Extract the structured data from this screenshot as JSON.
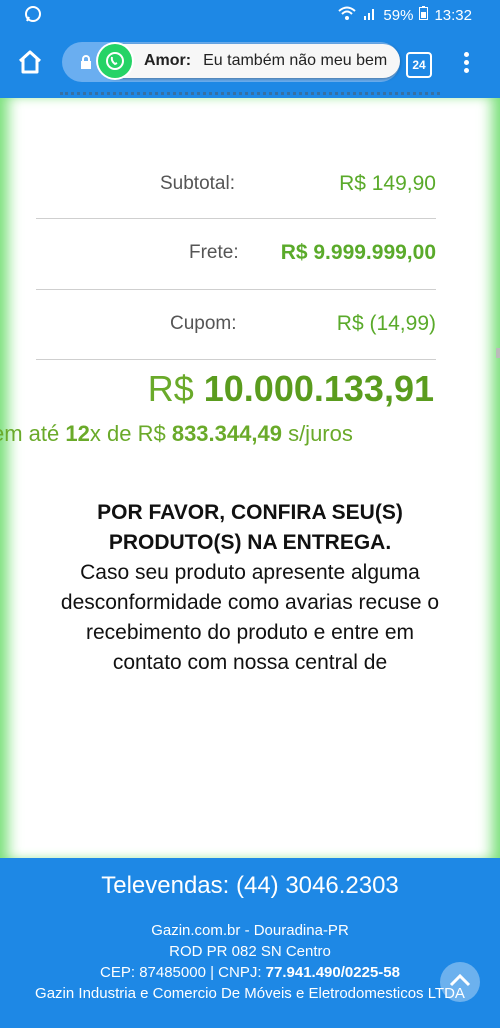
{
  "statusbar": {
    "battery": "59%",
    "time": "13:32",
    "left_icon": "whatsapp-icon"
  },
  "toolbar": {
    "tabs_count": "24"
  },
  "notification": {
    "sender": "Amor:",
    "message": "Eu também não meu bem"
  },
  "summary": {
    "subtotal_label": "Subtotal:",
    "subtotal_value": "R$ 149,90",
    "frete_label": "Frete:",
    "frete_value": "R$ 9.999.999,00",
    "cupom_label": "Cupom:",
    "cupom_value": "R$ (14,99)",
    "total_prefix": "R$",
    "total_value": "10.000.133,91",
    "install_prefix": "em até",
    "install_count": "12",
    "install_mid": "x de R$",
    "install_value": "833.344,49",
    "install_suffix": "s/juros"
  },
  "notice": {
    "line1": "POR FAVOR, CONFIRA SEU(S)",
    "line2": "PRODUTO(S) NA ENTREGA.",
    "line3": "Caso seu produto apresente alguma",
    "line4": "desconformidade como avarias recuse o",
    "line5": "recebimento do produto e entre em",
    "line6": "contato com nossa central de"
  },
  "footer": {
    "televendas": "Televendas: (44) 3046.2303",
    "site": "Gazin.com.br - Douradina-PR",
    "address": "ROD PR 082 SN Centro",
    "cep": "CEP: 87485000 | CNPJ:",
    "cnpj": "77.941.490/0225-58",
    "company": "Gazin Industria e Comercio De Móveis e Eletrodomesticos LTDA"
  },
  "colors": {
    "brand_blue": "#1e88e5",
    "price_green": "#5aaa2a",
    "glow_green": "#7be07b"
  }
}
